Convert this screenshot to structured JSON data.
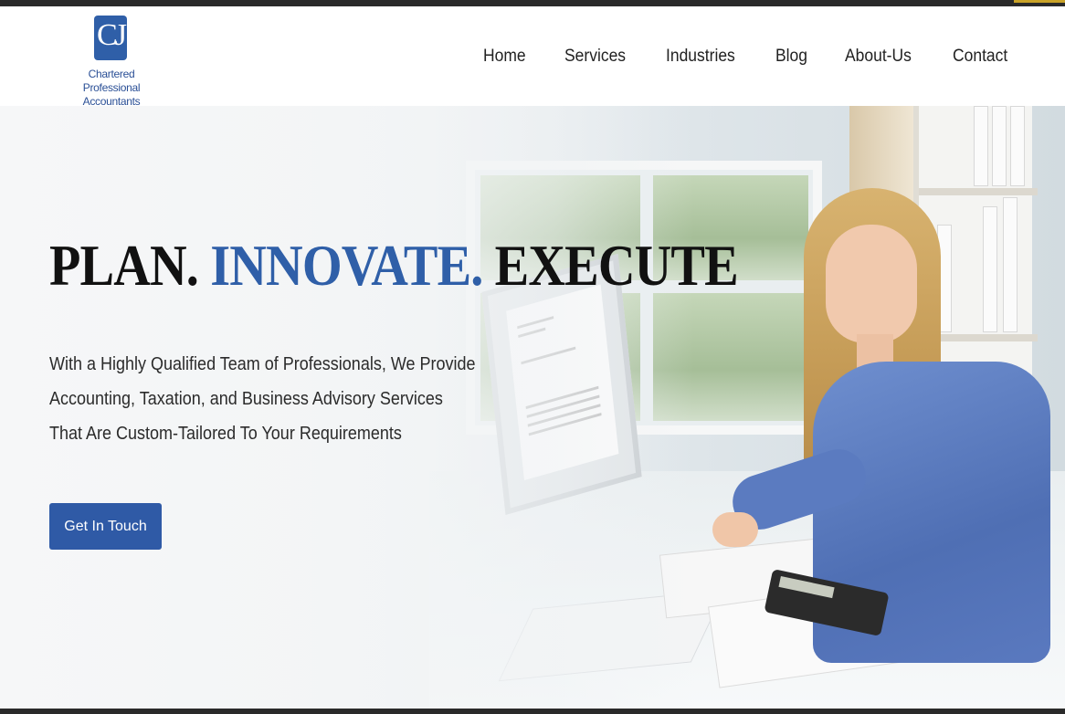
{
  "header": {
    "logo_initials": "CJ",
    "logo_line1": "Chartered Professional",
    "logo_line2": "Accountants"
  },
  "nav": {
    "items": [
      "Home",
      "Services",
      "Industries",
      "Blog",
      "About-Us",
      "Contact"
    ]
  },
  "hero": {
    "headline_part1": "PLAN.",
    "headline_part2": "INNOVATE.",
    "headline_part3": "EXECUTE",
    "subtext": "With a Highly Qualified Team of Professionals, We Provide Accounting, Taxation, and Business Advisory Services That Are Custom-Tailored To Your Requirements",
    "cta_label": "Get In Touch"
  },
  "colors": {
    "brand_blue": "#2f5fa8",
    "button_blue": "#2f5aa6",
    "headline_dark": "#111111"
  }
}
